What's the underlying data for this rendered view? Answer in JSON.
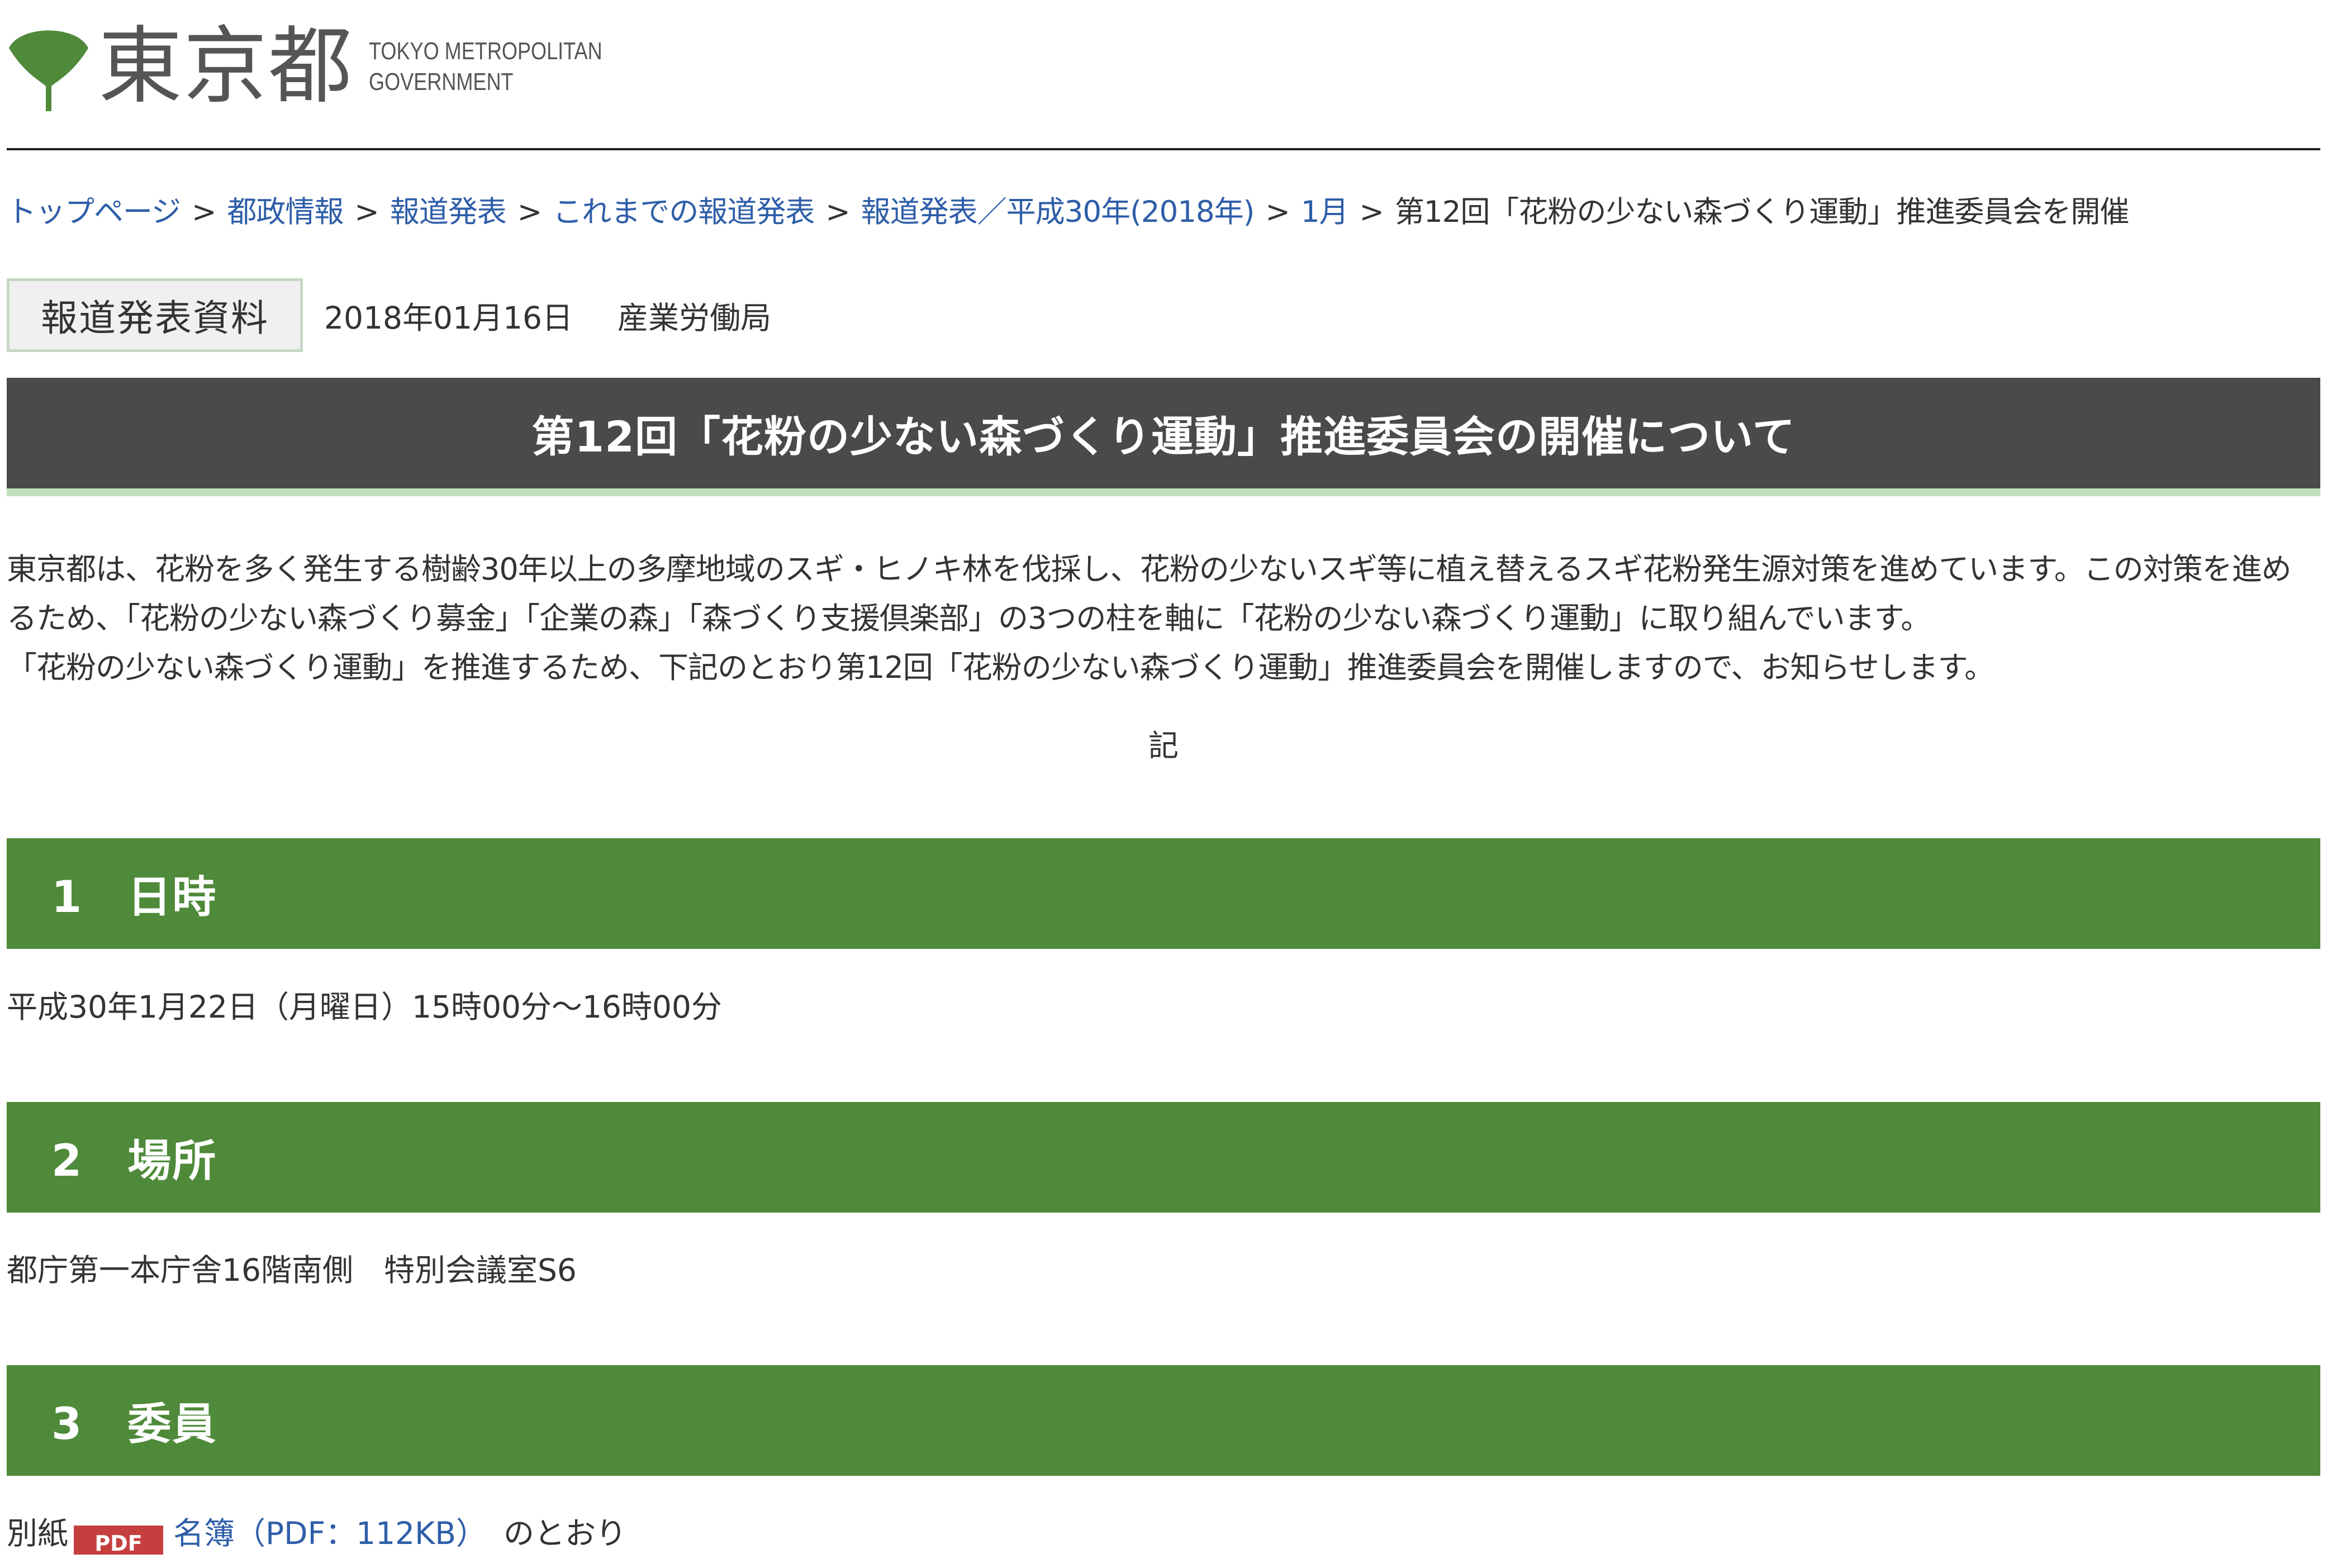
{
  "header": {
    "logo_text": "東京都",
    "logo_sub_line1": "TOKYO METROPOLITAN",
    "logo_sub_line2": "GOVERNMENT",
    "brand_color": "#4e8a3a"
  },
  "breadcrumb": {
    "items": [
      "トップページ",
      "都政情報",
      "報道発表",
      "これまでの報道発表",
      "報道発表／平成30年(2018年)",
      "1月"
    ],
    "separator": ">",
    "current": "第12回「花粉の少ない森づくり運動」推進委員会を開催"
  },
  "meta": {
    "badge": "報道発表資料",
    "date": "2018年01月16日",
    "department": "産業労働局"
  },
  "title": "第12回「花粉の少ない森づくり運動」推進委員会の開催について",
  "intro": {
    "paragraph1": "東京都は、花粉を多く発生する樹齢30年以上の多摩地域のスギ・ヒノキ林を伐採し、花粉の少ないスギ等に植え替えるスギ花粉発生源対策を進めています。この対策を進めるため、「花粉の少ない森づくり募金」「企業の森」「森づくり支援倶楽部」の3つの柱を軸に「花粉の少ない森づくり運動」に取り組んでいます。",
    "paragraph2": "「花粉の少ない森づくり運動」を推進するため、下記のとおり第12回「花粉の少ない森づくり運動」推進委員会を開催しますので、お知らせします。",
    "ki": "記"
  },
  "sections": [
    {
      "heading": "1　日時",
      "body": "平成30年1月22日（月曜日）15時00分～16時00分"
    },
    {
      "heading": "2　場所",
      "body": "都庁第一本庁舎16階南側　特別会議室S6"
    },
    {
      "heading": "3　委員",
      "body_prefix": "別紙",
      "pdf_icon": "PDF",
      "link": "名簿（PDF：112KB）",
      "body_suffix": "のとおり"
    }
  ]
}
